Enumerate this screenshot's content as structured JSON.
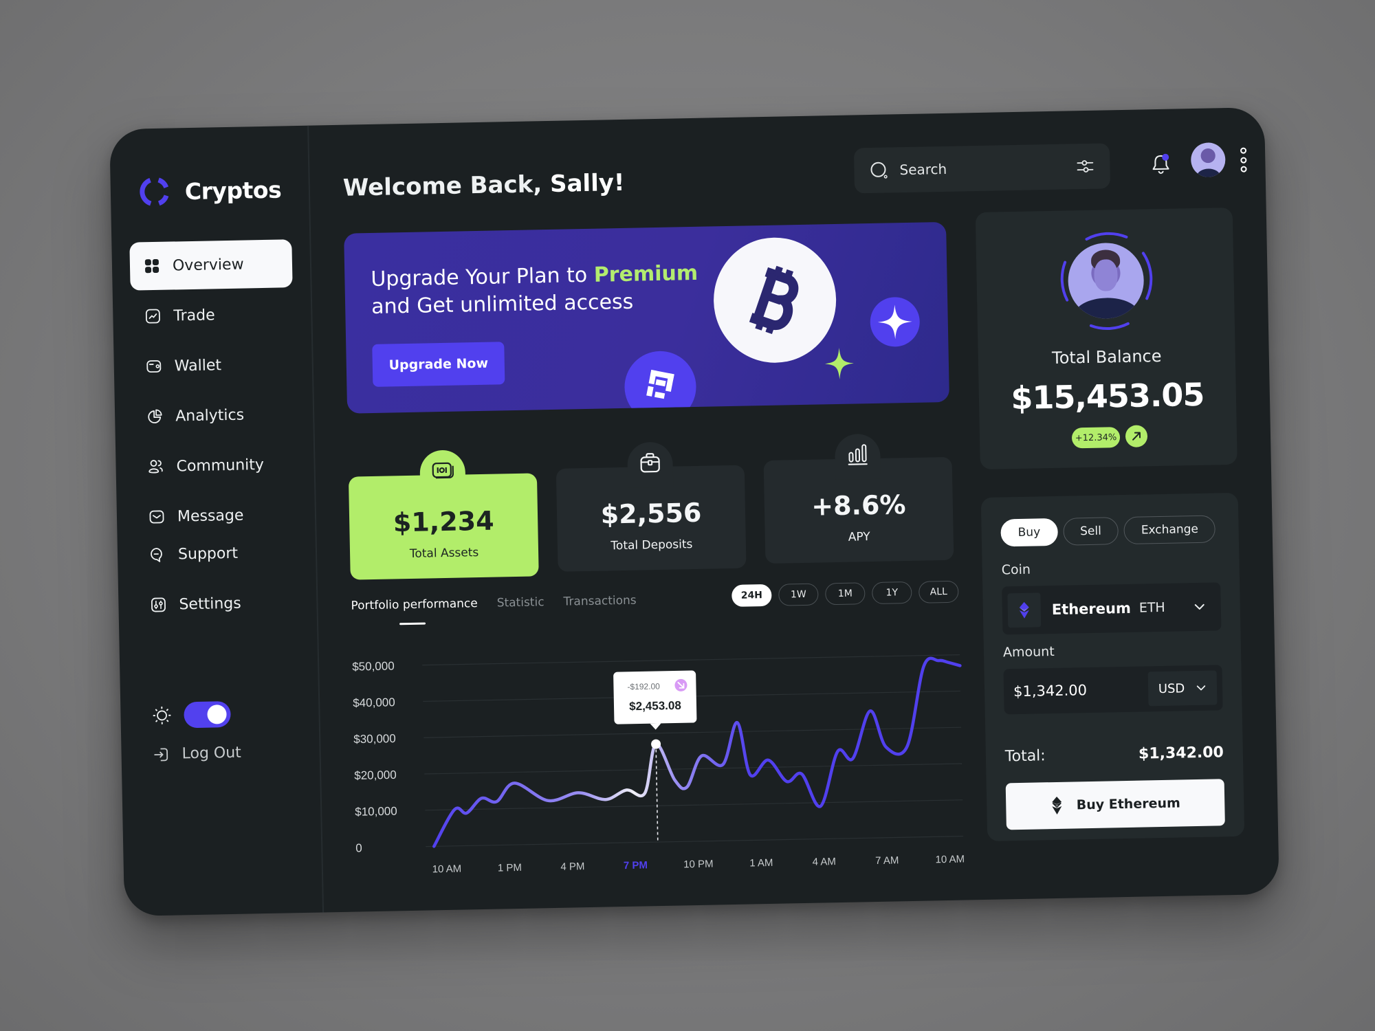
{
  "app": {
    "name": "Cryptos",
    "accent": "#5140ee",
    "lime": "#b2ed6a"
  },
  "sidebar": {
    "items": [
      {
        "label": "Overview",
        "icon": "grid-icon",
        "active": true
      },
      {
        "label": "Trade",
        "icon": "trend-icon"
      },
      {
        "label": "Wallet",
        "icon": "wallet-icon"
      },
      {
        "label": "Analytics",
        "icon": "pie-chart-icon"
      },
      {
        "label": "Community",
        "icon": "users-icon"
      },
      {
        "label": "Message",
        "icon": "message-icon"
      }
    ],
    "bottom_items": [
      {
        "label": "Support",
        "icon": "chat-icon"
      },
      {
        "label": "Settings",
        "icon": "sliders-icon"
      }
    ],
    "theme_toggle_on": true,
    "logout_label": "Log Out"
  },
  "header": {
    "welcome_prefix": "Welcome Back,",
    "user_name": "Sally!",
    "search_placeholder": "Search"
  },
  "banner": {
    "title_part1": "Upgrade Your Plan to",
    "title_highlight": "Premium",
    "title_part2": "and Get unlimited access",
    "button_label": "Upgrade Now"
  },
  "stats": [
    {
      "value": "$1,234",
      "label": "Total Assets",
      "icon": "money-icon"
    },
    {
      "value": "$2,556",
      "label": "Total Deposits",
      "icon": "briefcase-icon"
    },
    {
      "value": "+8.6%",
      "label": "APY",
      "icon": "bar-chart-icon"
    }
  ],
  "chart_section": {
    "tabs": [
      {
        "label": "Portfolio performance",
        "active": true
      },
      {
        "label": "Statistic"
      },
      {
        "label": "Transactions"
      }
    ],
    "ranges": [
      {
        "label": "24H",
        "active": true
      },
      {
        "label": "1W"
      },
      {
        "label": "1M"
      },
      {
        "label": "1Y"
      },
      {
        "label": "ALL"
      }
    ],
    "tooltip": {
      "change": "-$192.00",
      "value": "$2,453.08",
      "x_label": "7 PM"
    }
  },
  "chart_data": {
    "type": "line",
    "title": "Portfolio performance",
    "xlabel": "",
    "ylabel": "",
    "ylim": [
      0,
      50000
    ],
    "y_ticks": [
      0,
      10000,
      20000,
      30000,
      40000,
      50000
    ],
    "y_tick_labels": [
      "0",
      "$10,000",
      "$20,000",
      "$30,000",
      "$40,000",
      "$50,000"
    ],
    "x_tick_labels": [
      "10 AM",
      "1 PM",
      "4 PM",
      "7 PM",
      "10 PM",
      "1 AM",
      "4 AM",
      "7 AM",
      "10 AM"
    ],
    "highlight_x_label": "7 PM",
    "grid": true,
    "series": [
      {
        "name": "Portfolio",
        "x": [
          0,
          0.35,
          0.55,
          0.8,
          1.05,
          1.35,
          1.9,
          2.4,
          2.85,
          3.2,
          3.5,
          3.7,
          4.0,
          4.2,
          4.45,
          4.8,
          5.05,
          5.25,
          5.55,
          5.85,
          6.1,
          6.4,
          6.7,
          6.95,
          7.25,
          7.5,
          7.85,
          8.15,
          8.4,
          8.55,
          8.75
        ],
        "values": [
          0,
          10000,
          9000,
          13000,
          12000,
          17000,
          12000,
          14000,
          12000,
          14500,
          13500,
          27000,
          17000,
          15000,
          23500,
          21000,
          32500,
          18000,
          22000,
          16000,
          18000,
          9000,
          24000,
          22000,
          35000,
          25000,
          25000,
          47000,
          48500,
          48000,
          47000
        ]
      }
    ]
  },
  "balance": {
    "label": "Total Balance",
    "value": "$15,453.05",
    "change": "+12.34%"
  },
  "trade": {
    "tabs": [
      {
        "label": "Buy",
        "active": true
      },
      {
        "label": "Sell"
      },
      {
        "label": "Exchange"
      }
    ],
    "coin_label": "Coin",
    "coin_name": "Ethereum",
    "coin_symbol": "ETH",
    "amount_label": "Amount",
    "amount_value": "$1,342.00",
    "currency": "USD",
    "total_label": "Total:",
    "total_value": "$1,342.00",
    "buy_button_label": "Buy Ethereum"
  }
}
